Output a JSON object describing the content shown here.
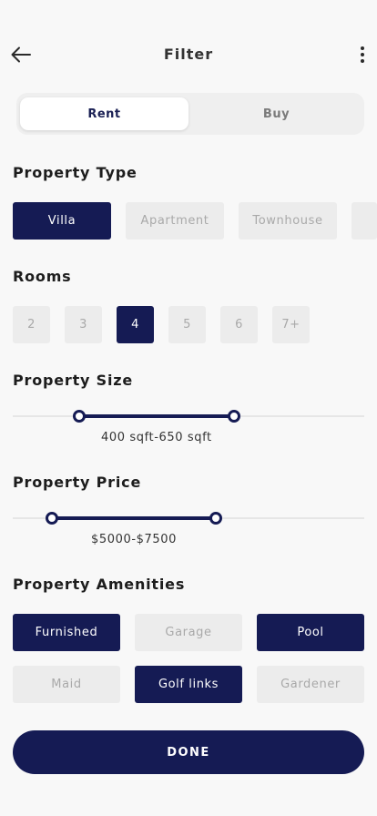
{
  "header": {
    "title": "Filter",
    "back_icon": "arrow-left-icon",
    "more_icon": "more-vertical-icon"
  },
  "segment": {
    "options": [
      "Rent",
      "Buy"
    ],
    "selected": "Rent"
  },
  "property_type": {
    "title": "Property Type",
    "options": [
      {
        "label": "Villa",
        "selected": true
      },
      {
        "label": "Apartment",
        "selected": false
      },
      {
        "label": "Townhouse",
        "selected": false
      }
    ]
  },
  "rooms": {
    "title": "Rooms",
    "options": [
      {
        "label": "2",
        "selected": false
      },
      {
        "label": "3",
        "selected": false
      },
      {
        "label": "4",
        "selected": true
      },
      {
        "label": "5",
        "selected": false
      },
      {
        "label": "6",
        "selected": false
      },
      {
        "label": "7+",
        "selected": false
      }
    ]
  },
  "property_size": {
    "title": "Property Size",
    "range_label": "400 sqft-650 sqft",
    "min": 400,
    "max": 650
  },
  "property_price": {
    "title": "Property Price",
    "range_label": "$5000-$7500",
    "min": 5000,
    "max": 7500
  },
  "amenities": {
    "title": "Property Amenities",
    "options": [
      {
        "label": "Furnished",
        "selected": true
      },
      {
        "label": "Garage",
        "selected": false
      },
      {
        "label": "Pool",
        "selected": true
      },
      {
        "label": "Maid",
        "selected": false
      },
      {
        "label": "Golf links",
        "selected": true
      },
      {
        "label": "Gardener",
        "selected": false
      }
    ]
  },
  "done_label": "DONE",
  "colors": {
    "primary": "#151b54",
    "chip_off": "#ececec",
    "background": "#f8f8f8"
  }
}
